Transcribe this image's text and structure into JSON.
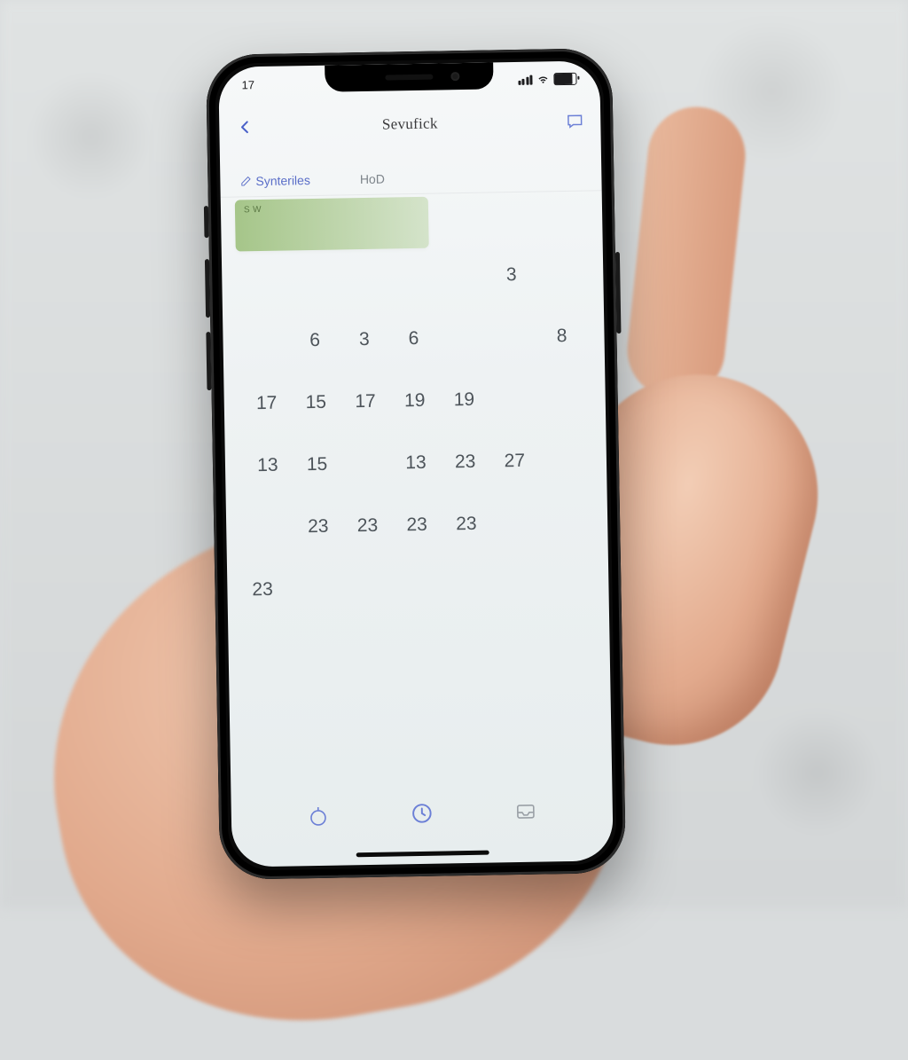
{
  "status": {
    "time": "17"
  },
  "nav": {
    "title": "Sevufick"
  },
  "tabs": {
    "active": "Synteriles",
    "secondary": "HoD"
  },
  "highlight": {
    "label": "S W"
  },
  "calendar": {
    "rows": [
      [
        "",
        "",
        "",
        "",
        "",
        "3",
        ""
      ],
      [
        "",
        "6",
        "3",
        "6",
        "",
        "",
        "8"
      ],
      [
        "17",
        "15",
        "17",
        "19",
        "19",
        "",
        ""
      ],
      [
        "13",
        "15",
        "",
        "13",
        "23",
        "27",
        ""
      ],
      [
        "",
        "23",
        "23",
        "23",
        "23",
        "",
        ""
      ],
      [
        "23",
        "",
        "",
        "",
        "",
        "",
        ""
      ]
    ]
  }
}
